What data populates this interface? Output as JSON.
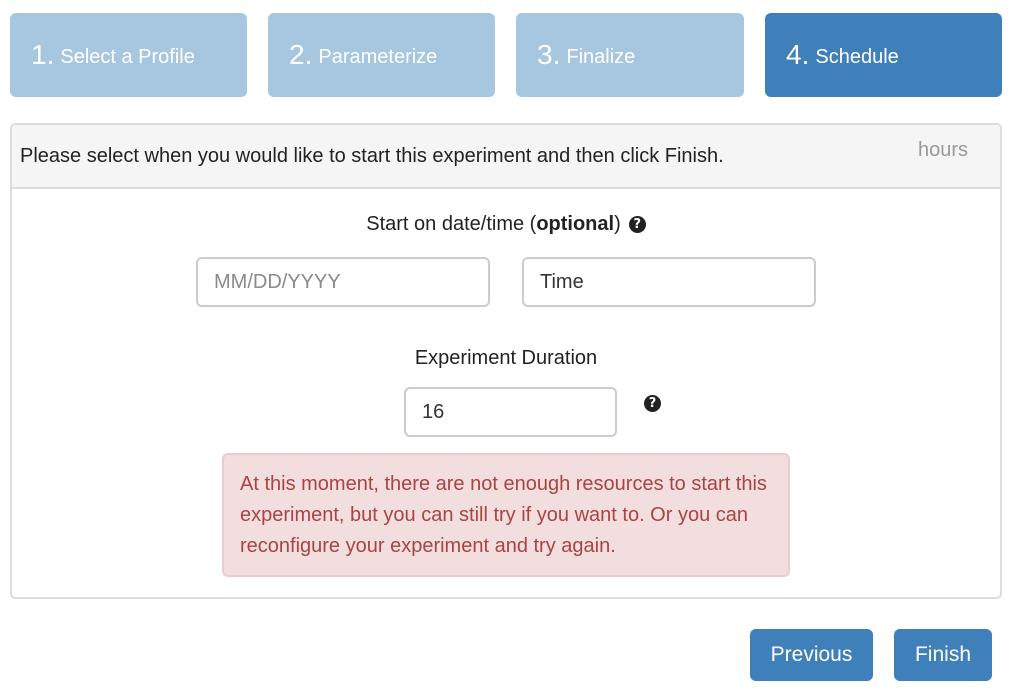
{
  "wizard": {
    "steps": [
      {
        "number": "1.",
        "label": "Select a Profile",
        "active": false
      },
      {
        "number": "2.",
        "label": "Parameterize",
        "active": false
      },
      {
        "number": "3.",
        "label": "Finalize",
        "active": false
      },
      {
        "number": "4.",
        "label": "Schedule",
        "active": true
      }
    ]
  },
  "panel": {
    "heading": "Please select when you would like to start this experiment and then click Finish.",
    "hours_label": "hours"
  },
  "schedule": {
    "start_label_prefix": "Start on date/time (",
    "start_label_bold": "optional",
    "start_label_suffix": ")",
    "help_icon": "question-circle-icon",
    "date_placeholder": "MM/DD/YYYY",
    "date_value": "",
    "time_value": "Time",
    "duration_label": "Experiment Duration",
    "duration_value": "16"
  },
  "alert": {
    "message": "At this moment, there are not enough resources to start this experiment, but you can still try if you want to. Or you can reconfigure your experiment and try again."
  },
  "buttons": {
    "previous": "Previous",
    "finish": "Finish"
  },
  "colors": {
    "step_inactive": "#a7c6e0",
    "step_active": "#3f7fba",
    "button": "#3f7fba",
    "alert_bg": "#f2dede",
    "alert_text": "#a94442"
  }
}
